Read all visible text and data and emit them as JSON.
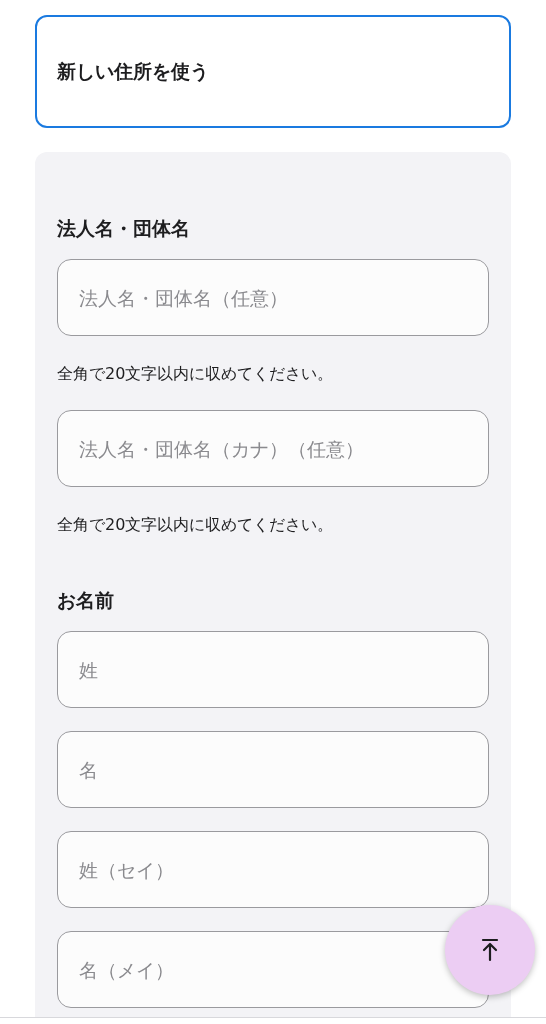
{
  "address_option": {
    "label": "新しい住所を使う",
    "selected": true
  },
  "sections": [
    {
      "heading": "法人名・団体名",
      "fields": [
        {
          "placeholder": "法人名・団体名（任意）",
          "hint": "全角で20文字以内に収めてください。"
        },
        {
          "placeholder": "法人名・団体名（カナ）（任意）",
          "hint": "全角で20文字以内に収めてください。"
        }
      ]
    },
    {
      "heading": "お名前",
      "fields": [
        {
          "placeholder": "姓"
        },
        {
          "placeholder": "名"
        },
        {
          "placeholder": "姓（セイ）"
        },
        {
          "placeholder": "名（メイ）"
        }
      ]
    }
  ]
}
